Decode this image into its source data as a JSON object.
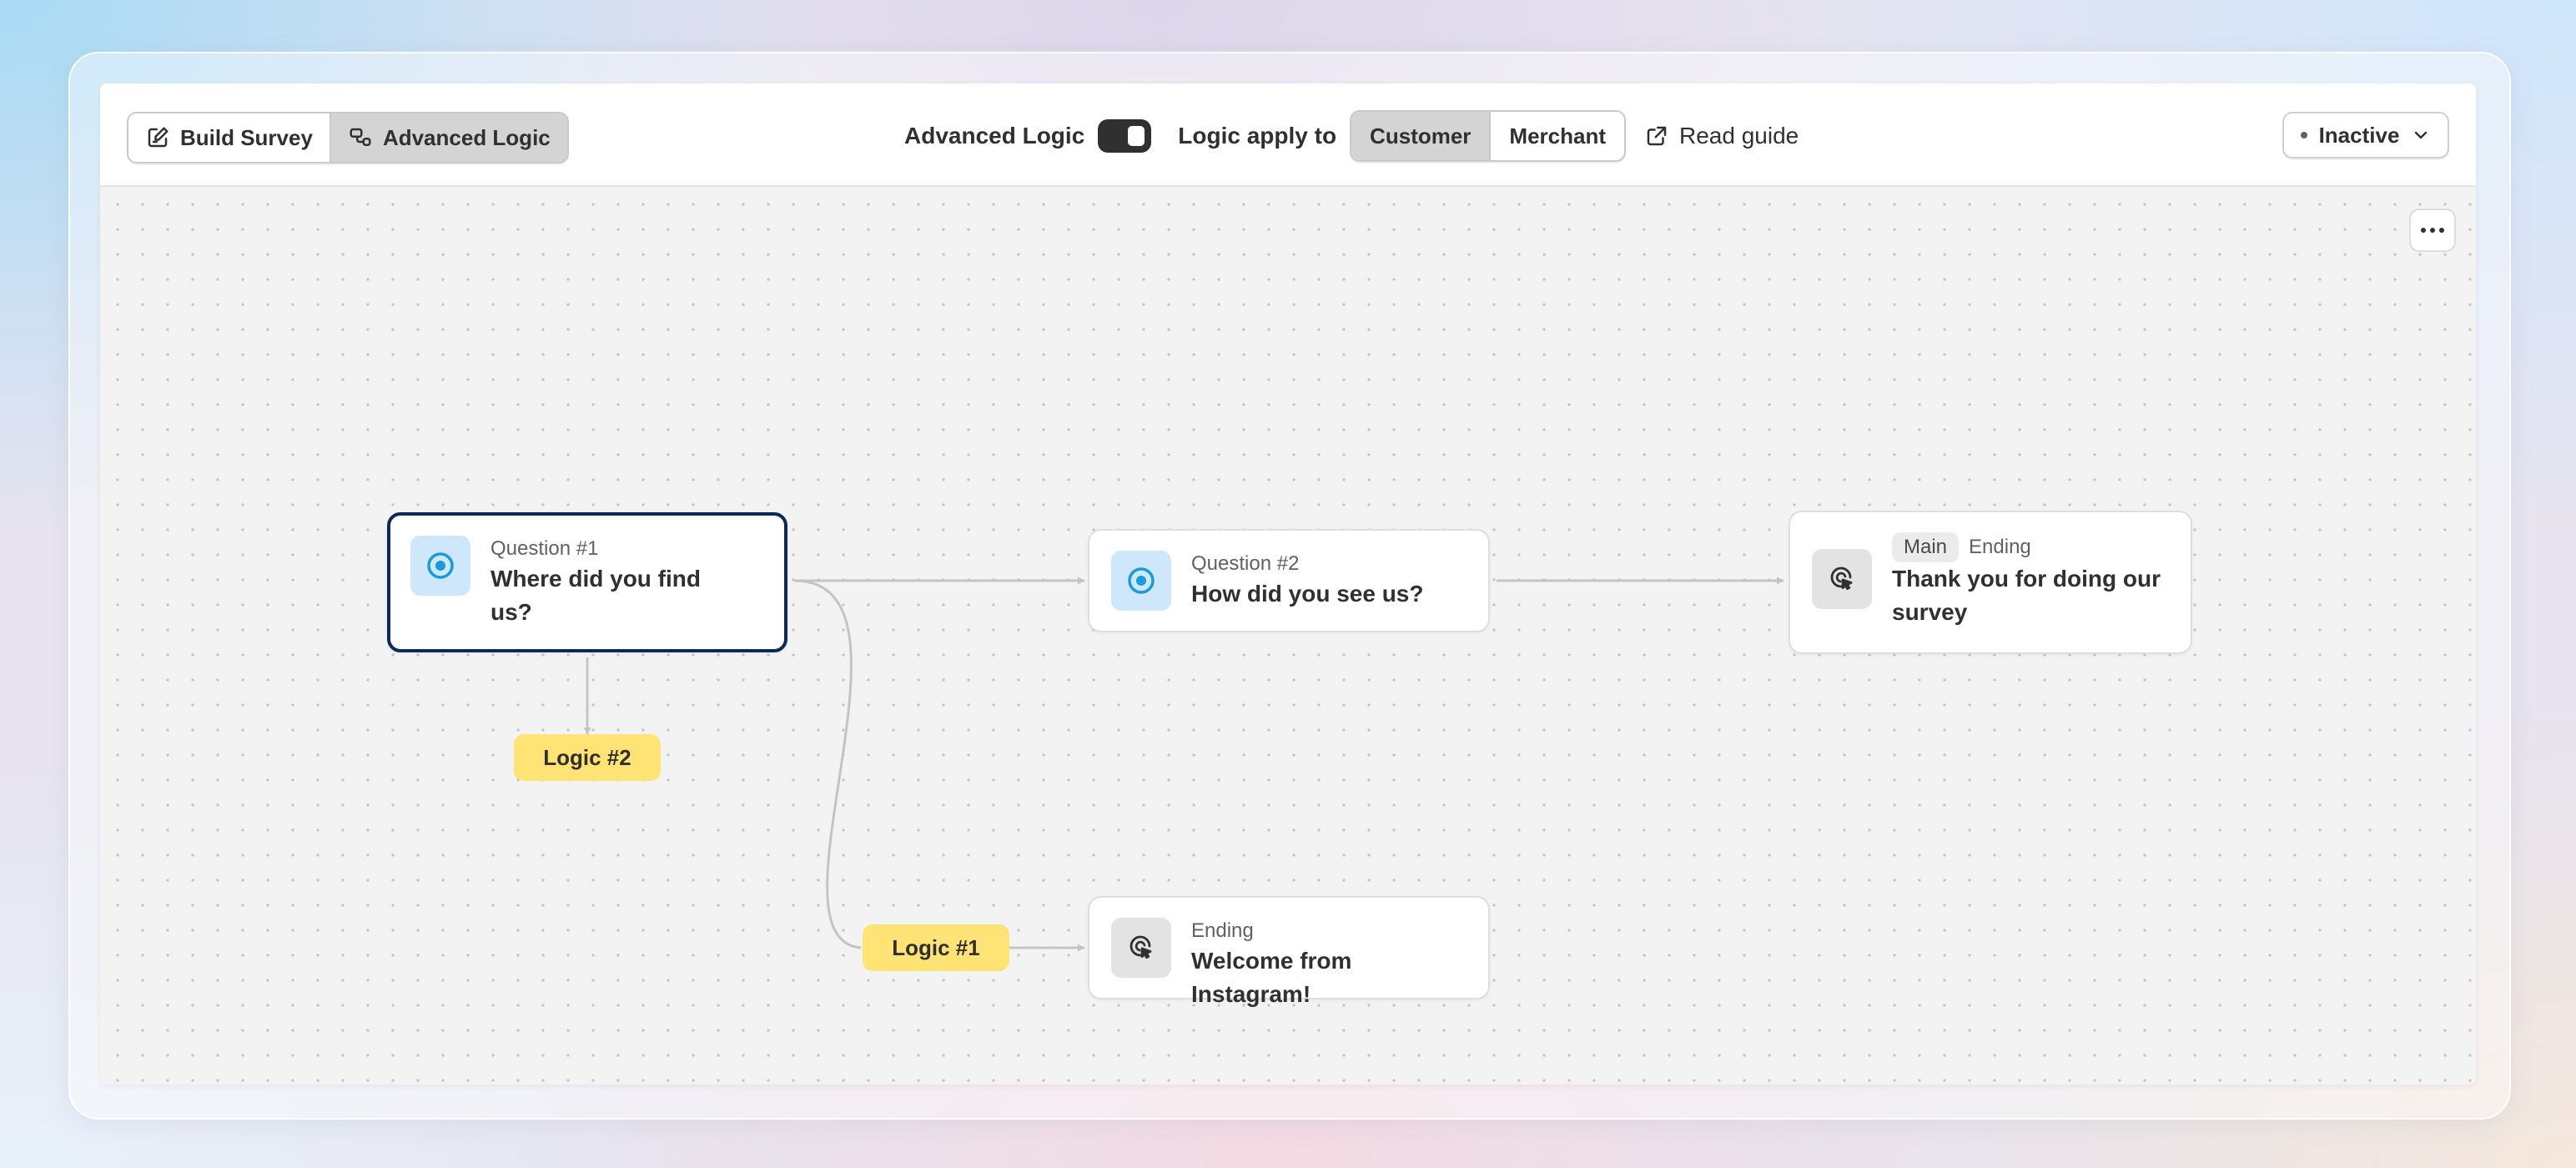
{
  "toolbar": {
    "view_tabs": [
      {
        "label": "Build Survey",
        "icon": "edit-icon"
      },
      {
        "label": "Advanced Logic",
        "icon": "logic-icon",
        "active": true
      }
    ],
    "advanced_logic_label": "Advanced Logic",
    "advanced_logic_enabled": true,
    "logic_apply_label": "Logic apply to",
    "apply_options": [
      {
        "label": "Customer",
        "active": true
      },
      {
        "label": "Merchant"
      }
    ],
    "read_guide_label": "Read guide",
    "status_value": "Inactive"
  },
  "flow": {
    "question1": {
      "subtitle": "Question #1",
      "title": "Where did you find us?",
      "icon": "radio-icon",
      "selected": true
    },
    "question2": {
      "subtitle": "Question #2",
      "title": "How did you see us?",
      "icon": "radio-icon"
    },
    "ending_main": {
      "tag": "Main",
      "subtitle": "Ending",
      "title": "Thank you for doing our survey",
      "icon": "cursor-click-icon"
    },
    "ending_instagram": {
      "subtitle": "Ending",
      "title": "Welcome from Instagram!",
      "icon": "cursor-click-icon"
    },
    "logic2_label": "Logic #2",
    "logic1_label": "Logic #1"
  },
  "colors": {
    "selected_border": "#0b2a57",
    "logic_badge": "#ffe374",
    "question_icon_bg": "#cfe7fb",
    "radio_accent": "#1a9cd8",
    "edge": "#c4c4c4"
  }
}
